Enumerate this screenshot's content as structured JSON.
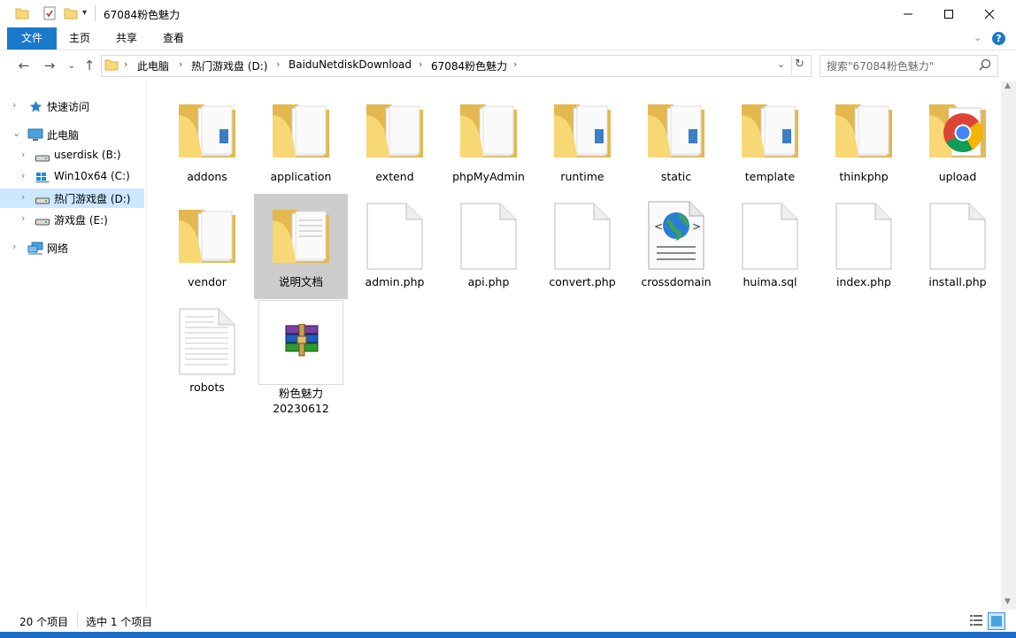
{
  "window": {
    "title": "67084粉色魅力",
    "controls": [
      "minimize-icon",
      "maximize-icon",
      "close-icon"
    ]
  },
  "ribbon": {
    "tabs": [
      "文件",
      "主页",
      "共享",
      "查看"
    ],
    "active_tab": "文件",
    "accent": "#1979ca"
  },
  "address": {
    "breadcrumbs": [
      "此电脑",
      "热门游戏盘 (D:)",
      "BaiduNetdiskDownload",
      "67084粉色魅力"
    ],
    "search_placeholder": "搜索\"67084粉色魅力\""
  },
  "nav": {
    "items": [
      {
        "label": "快速访问",
        "icon": "star-icon"
      },
      {
        "label": "此电脑",
        "icon": "computer-icon"
      },
      {
        "label": "userdisk (B:)",
        "icon": "drive-icon"
      },
      {
        "label": "Win10x64 (C:)",
        "icon": "windows-drive-icon"
      },
      {
        "label": "热门游戏盘 (D:)",
        "icon": "drive-icon",
        "selected": true
      },
      {
        "label": "游戏盘 (E:)",
        "icon": "drive-icon"
      },
      {
        "label": "网络",
        "icon": "network-icon"
      }
    ]
  },
  "files": {
    "items": [
      {
        "name": "addons",
        "type": "folder"
      },
      {
        "name": "application",
        "type": "folder"
      },
      {
        "name": "extend",
        "type": "folder"
      },
      {
        "name": "phpMyAdmin",
        "type": "folder"
      },
      {
        "name": "runtime",
        "type": "folder"
      },
      {
        "name": "static",
        "type": "folder"
      },
      {
        "name": "template",
        "type": "folder"
      },
      {
        "name": "thinkphp",
        "type": "folder"
      },
      {
        "name": "upload",
        "type": "folder-chrome"
      },
      {
        "name": "vendor",
        "type": "folder"
      },
      {
        "name": "说明文档",
        "type": "folder",
        "selected": true
      },
      {
        "name": "admin.php",
        "type": "file"
      },
      {
        "name": "api.php",
        "type": "file"
      },
      {
        "name": "convert.php",
        "type": "file"
      },
      {
        "name": "crossdomain",
        "type": "xml-file"
      },
      {
        "name": "huima.sql",
        "type": "file"
      },
      {
        "name": "index.php",
        "type": "file"
      },
      {
        "name": "install.php",
        "type": "file"
      },
      {
        "name": "robots",
        "type": "text-file"
      },
      {
        "name": "粉色魅力\n20230612",
        "type": "rar-archive",
        "focused": true
      }
    ]
  },
  "status": {
    "count": "20 个项目",
    "selection": "选中 1 个项目"
  }
}
